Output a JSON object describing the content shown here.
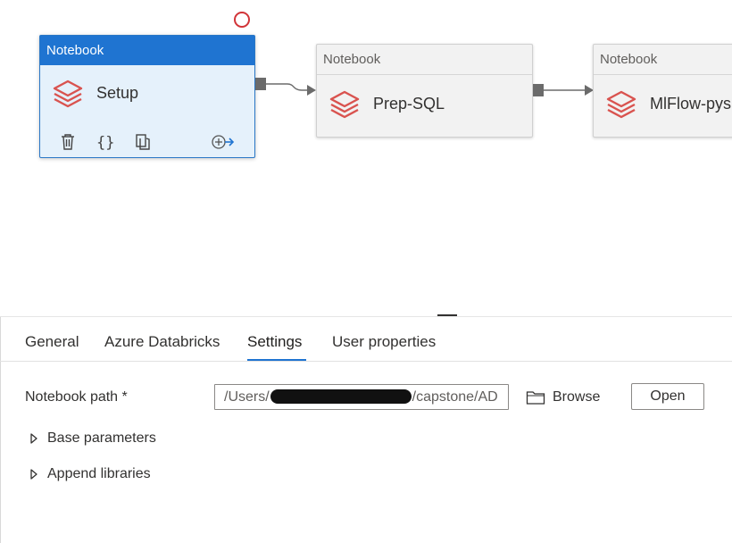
{
  "canvas": {
    "activities": [
      {
        "header": "Notebook",
        "name": "Setup",
        "selected": true
      },
      {
        "header": "Notebook",
        "name": "Prep-SQL",
        "selected": false
      },
      {
        "header": "Notebook",
        "name": "MlFlow-pysp",
        "selected": false
      }
    ],
    "toolbar_icons": [
      "delete-icon",
      "code-braces-icon",
      "copy-icon",
      "add-output-icon"
    ],
    "activity_icon": "databricks-stack-icon"
  },
  "tabs": [
    {
      "label": "General",
      "active": false
    },
    {
      "label": "Azure Databricks",
      "active": false
    },
    {
      "label": "Settings",
      "active": true
    },
    {
      "label": "User properties",
      "active": false
    }
  ],
  "settings": {
    "notebook_path_label": "Notebook path *",
    "notebook_path_prefix": "/Users/",
    "notebook_path_suffix": "/capstone/AD",
    "browse_label": "Browse",
    "open_label": "Open",
    "base_parameters_label": "Base parameters",
    "append_libraries_label": "Append libraries"
  },
  "colors": {
    "accent": "#1f74d1",
    "selected_fill": "#e5f1fb",
    "databricks_red": "#d9534f",
    "status_circle": "#d13438"
  }
}
